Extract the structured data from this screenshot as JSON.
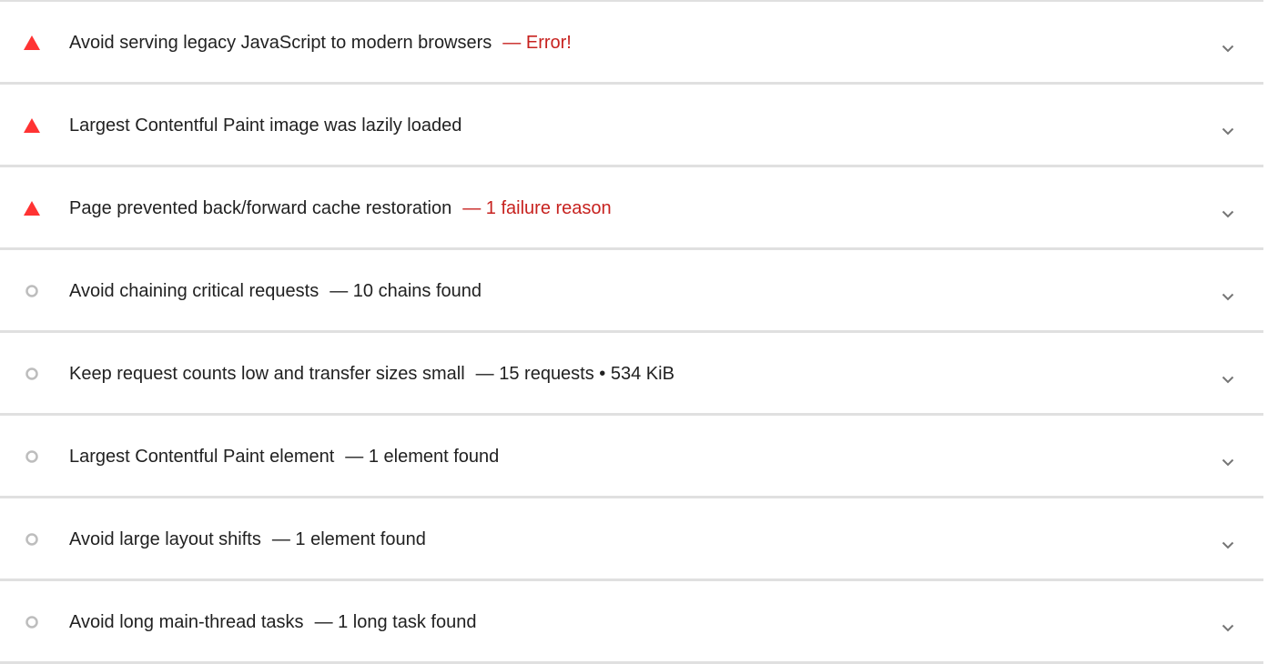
{
  "colors": {
    "fail": "#f33",
    "fail_text": "#c7221f",
    "info_icon": "#bdbdbd",
    "divider": "#e0e0e0",
    "chevron": "#757575"
  },
  "audits": [
    {
      "status": "fail",
      "icon": "red-triangle-icon",
      "title": "Avoid serving legacy JavaScript to modern browsers",
      "display_value": "— Error!"
    },
    {
      "status": "fail",
      "icon": "red-triangle-icon",
      "title": "Largest Contentful Paint image was lazily loaded",
      "display_value": ""
    },
    {
      "status": "fail",
      "icon": "red-triangle-icon",
      "title": "Page prevented back/forward cache restoration",
      "display_value": "— 1 failure reason"
    },
    {
      "status": "info",
      "icon": "gray-circle-icon",
      "title": "Avoid chaining critical requests",
      "display_value": "— 10 chains found"
    },
    {
      "status": "info",
      "icon": "gray-circle-icon",
      "title": "Keep request counts low and transfer sizes small",
      "display_value": "— 15 requests • 534 KiB"
    },
    {
      "status": "info",
      "icon": "gray-circle-icon",
      "title": "Largest Contentful Paint element",
      "display_value": "— 1 element found"
    },
    {
      "status": "info",
      "icon": "gray-circle-icon",
      "title": "Avoid large layout shifts",
      "display_value": "— 1 element found"
    },
    {
      "status": "info",
      "icon": "gray-circle-icon",
      "title": "Avoid long main-thread tasks",
      "display_value": "— 1 long task found"
    }
  ]
}
